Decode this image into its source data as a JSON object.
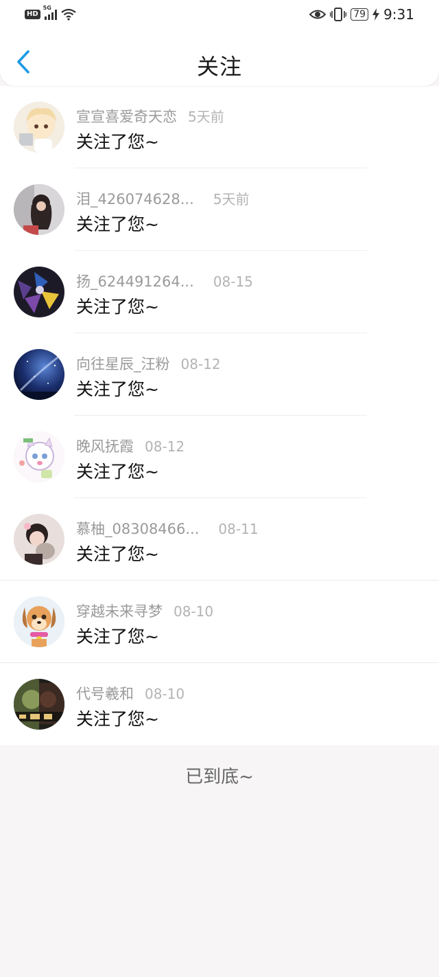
{
  "status_bar": {
    "hd_label": "HD",
    "network_label": "5G",
    "battery_level": "79",
    "time": "9:31",
    "icons": [
      "signal-icon",
      "wifi-icon",
      "eye-icon",
      "vibrate-icon",
      "battery-icon",
      "charging-icon"
    ]
  },
  "nav": {
    "title": "关注",
    "back_icon": "chevron-left-icon",
    "accent_color": "#1a9ae6"
  },
  "followers": [
    {
      "name": "宣宣喜爱奇天恋",
      "time": "5天前",
      "message": "关注了您~"
    },
    {
      "name": "泪_426074628...",
      "time": "5天前",
      "message": "关注了您~"
    },
    {
      "name": "扬_624491264...",
      "time": "08-15",
      "message": "关注了您~"
    },
    {
      "name": "向往星辰_汪粉",
      "time": "08-12",
      "message": "关注了您~"
    },
    {
      "name": "晚风抚霞",
      "time": "08-12",
      "message": "关注了您~"
    },
    {
      "name": "慕柚_08308466...",
      "time": "08-11",
      "message": "关注了您~"
    },
    {
      "name": "穿越未来寻梦",
      "time": "08-10",
      "message": "关注了您~"
    },
    {
      "name": "代号羲和",
      "time": "08-10",
      "message": "关注了您~"
    }
  ],
  "footer": {
    "text": "已到底~"
  }
}
